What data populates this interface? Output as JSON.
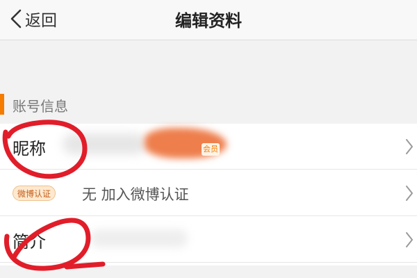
{
  "header": {
    "back_label": "返回",
    "title": "编辑资料",
    "back_icon": "chevron-left-icon"
  },
  "account_section": {
    "title": "账号信息",
    "accent_color": "#f57c00"
  },
  "rows": {
    "nickname": {
      "label": "昵称",
      "member_badge": "会员"
    },
    "verification": {
      "badge": "微博认证",
      "text": "无 加入微博认证"
    },
    "bio": {
      "label": "简介"
    }
  },
  "annotation": {
    "color": "#e11d2a",
    "shape": "freehand-circle"
  },
  "icons": {
    "row_chevron": "chevron-right-icon"
  }
}
